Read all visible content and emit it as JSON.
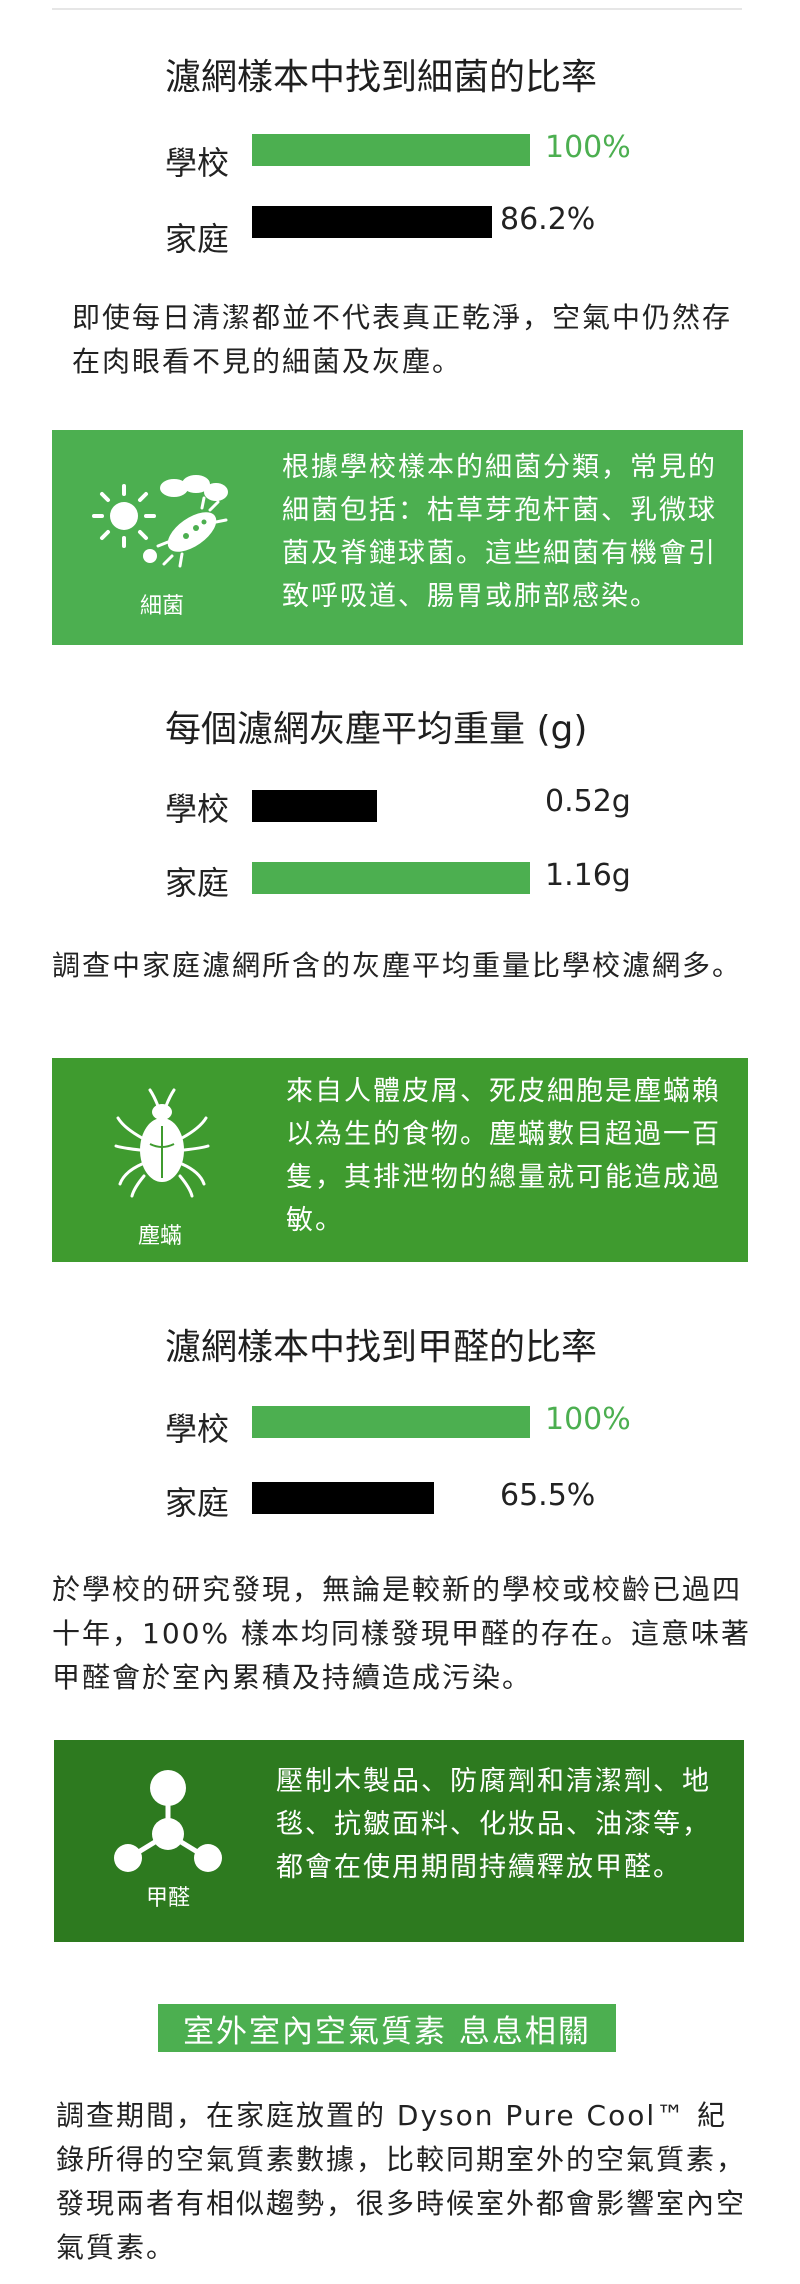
{
  "colors": {
    "green_bar": "#4caf50",
    "black_bar": "#000000",
    "box_light": "#4caf50",
    "box_mid": "#3f9b2f",
    "box_dark": "#2d7a1f"
  },
  "bacteria": {
    "title": "濾網樣本中找到細菌的比率",
    "rows": [
      {
        "label": "學校",
        "value_text": "100%",
        "percent": 100
      },
      {
        "label": "家庭",
        "value_text": "86.2%",
        "percent": 86.2
      }
    ],
    "paragraph": "即使每日清潔都並不代表真正乾淨，空氣中仍然存在肉眼看不見的細菌及灰塵。",
    "box": {
      "icon": "bacteria-icon",
      "caption": "細菌",
      "text": "根據學校樣本的細菌分類，常見的細菌包括：枯草芽孢杆菌、乳微球菌及脊鏈球菌。這些細菌有機會引致呼吸道、腸胃或肺部感染。"
    }
  },
  "dust": {
    "title": "每個濾網灰塵平均重量 (g)",
    "rows": [
      {
        "label": "學校",
        "value_text": "0.52g",
        "value": 0.52
      },
      {
        "label": "家庭",
        "value_text": "1.16g",
        "value": 1.16
      }
    ],
    "paragraph": "調查中家庭濾網所含的灰塵平均重量比學校濾網多。",
    "box": {
      "icon": "dust-mite-icon",
      "caption": "塵蟎",
      "text": "來自人體皮屑、死皮細胞是塵蟎賴以為生的食物。塵蟎數目超過一百隻，其排泄物的總量就可能造成過敏。"
    }
  },
  "formaldehyde": {
    "title": "濾網樣本中找到甲醛的比率",
    "rows": [
      {
        "label": "學校",
        "value_text": "100%",
        "percent": 100
      },
      {
        "label": "家庭",
        "value_text": "65.5%",
        "percent": 65.5
      }
    ],
    "paragraph": "於學校的研究發現，無論是較新的學校或校齡已過四十年，100% 樣本均同樣發現甲醛的存在。這意味著甲醛會於室內累積及持續造成污染。",
    "box": {
      "icon": "molecule-icon",
      "caption": "甲醛",
      "text": "壓制木製品、防腐劑和清潔劑、地毯、抗皺面料、化妝品、油漆等，都會在使用期間持續釋放甲醛。"
    }
  },
  "outdoor": {
    "banner": "室外室內空氣質素 息息相關",
    "paragraph": "調查期間，在家庭放置的 Dyson Pure Cool™ 紀錄所得的空氣質素數據，比較同期室外的空氣質素，發現兩者有相似趨勢，很多時候室外都會影響室內空氣質素。"
  }
}
